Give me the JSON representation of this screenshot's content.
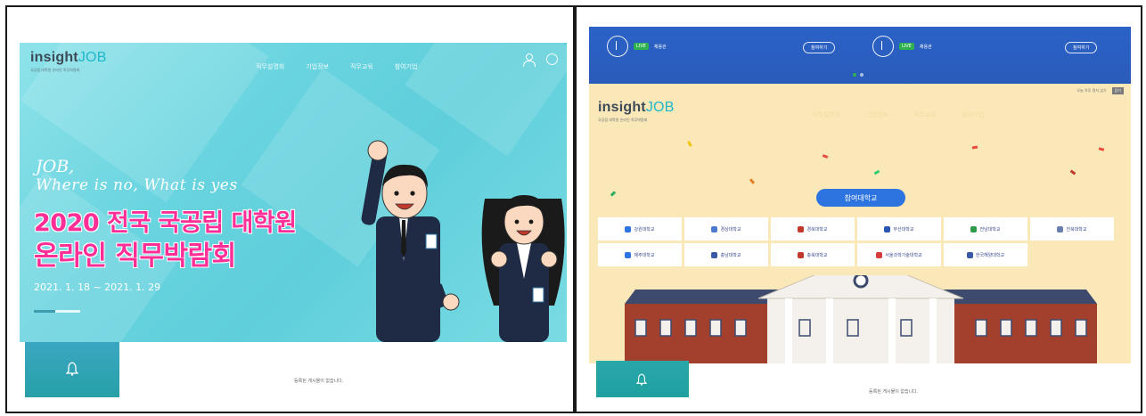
{
  "left": {
    "logo": {
      "word_main": "insight",
      "word_accent": "JOB",
      "tagline": "국공립 대학원 온라인 직무박람회"
    },
    "nav": [
      "직무설명회",
      "기업정보",
      "직무교육",
      "참여기업"
    ],
    "slogan_line1": "JOB,",
    "slogan_line2": "Where is no, What is yes",
    "title_line1": "2020 전국 국공립 대학원",
    "title_line2": "온라인 직무박람회",
    "date_range": "2021. 1. 18 ~ 2021. 1. 29",
    "notice_text": "등록된 게시물이 없습니다."
  },
  "right": {
    "topbar": {
      "player1_tag": "LIVE",
      "player1_label": "채용관",
      "player1_button": "참여하기",
      "player2_tag": "LIVE",
      "player2_label": "채용관",
      "player2_button": "참여하기"
    },
    "mini_bar": {
      "text": "오늘 하루 열지 않기",
      "button": "닫기"
    },
    "logo": {
      "word_main": "insight",
      "word_accent": "JOB",
      "tagline": "국공립 대학원 온라인 직무박람회"
    },
    "nav": [
      "직무설명회",
      "기업정보",
      "직무교육",
      "참여기업"
    ],
    "participating_button": "참여대학교",
    "universities": [
      {
        "name": "강원대학교",
        "color": "#2e74e0"
      },
      {
        "name": "경상대학교",
        "color": "#4a7bd0"
      },
      {
        "name": "경북대학교",
        "color": "#c0392b"
      },
      {
        "name": "부산대학교",
        "color": "#2c56b4"
      },
      {
        "name": "전남대학교",
        "color": "#2f9a4a"
      },
      {
        "name": "전북대학교",
        "color": "#6b7fae"
      },
      {
        "name": "제주대학교",
        "color": "#2e74e0"
      },
      {
        "name": "충남대학교",
        "color": "#3a5aa8"
      },
      {
        "name": "충북대학교",
        "color": "#c0392b"
      },
      {
        "name": "서울과학기술대학교",
        "color": "#d63b3b"
      },
      {
        "name": "한국해양대학교",
        "color": "#3a5aa8"
      }
    ],
    "notice_text": "등록된 게시물이 없습니다."
  }
}
